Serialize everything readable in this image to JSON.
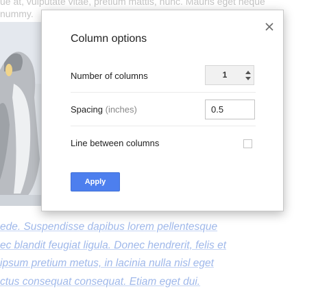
{
  "background": {
    "top_text": "ue at, vulputate vitae, pretium mattis, nunc. Mauris eget neque",
    "top_text_2": "nummy.",
    "body_lines": [
      "ede. Suspendisse dapibus lorem pellentesque",
      "ec blandit feugiat ligula. Donec hendrerit, felis et",
      "ipsum pretium metus, in lacinia nulla nisl eget",
      "ctus consequat consequat. Etiam eget dui."
    ]
  },
  "dialog": {
    "title": "Column options",
    "close_icon": "close-icon",
    "rows": {
      "columns": {
        "label": "Number of columns",
        "value": "1"
      },
      "spacing": {
        "label": "Spacing",
        "unit": "(inches)",
        "value": "0.5"
      },
      "line": {
        "label": "Line between columns",
        "checked": false
      }
    },
    "apply_label": "Apply"
  },
  "colors": {
    "accent": "#4d7fee",
    "link_text": "#9fb8ea"
  }
}
